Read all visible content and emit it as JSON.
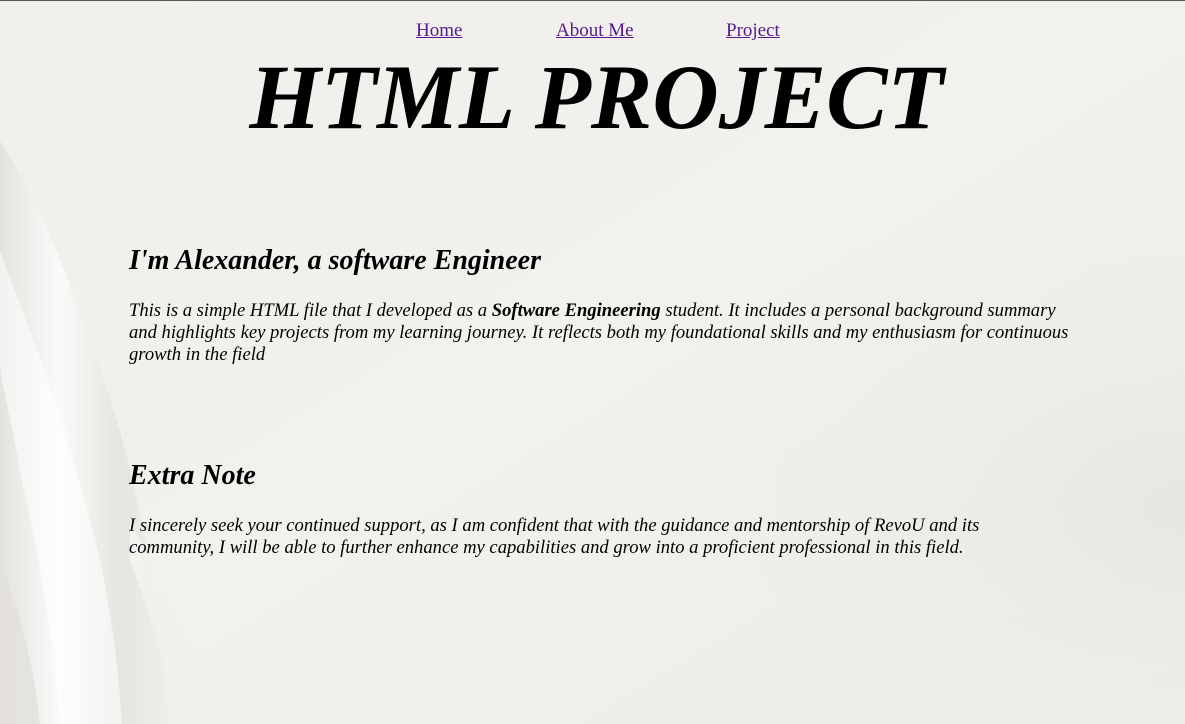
{
  "nav": {
    "home_label": "Home",
    "about_label": "About Me",
    "project_label": "Project"
  },
  "header": {
    "title": "HTML PROJECT"
  },
  "intro": {
    "heading": "I'm Alexander, a software Engineer",
    "text_before": "This is a simple HTML file that I developed as a ",
    "emphasis": "Software Engineering",
    "text_after": " student. It includes a personal background summary and highlights key projects from my learning journey. It reflects both my foundational skills and my enthusiasm for continuous growth in the field"
  },
  "note": {
    "heading": "Extra Note",
    "text": "I sincerely seek your continued support, as I am confident that with the guidance and mentorship of RevoU and its community, I will be able to further enhance my capabilities and grow into a proficient professional in this field."
  },
  "colors": {
    "link_visited": "#551a8b",
    "text": "#000000",
    "background": "#f2f0ec"
  }
}
